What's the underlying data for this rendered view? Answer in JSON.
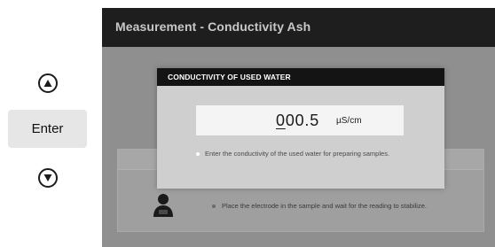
{
  "controls": {
    "up_icon": "triangle-up-icon",
    "enter_label": "Enter",
    "down_icon": "triangle-down-icon"
  },
  "screen": {
    "title": "Measurement - Conductivity Ash",
    "background_hint": "Place the electrode in the sample and wait for the reading to stabilize.",
    "background_icon": "electrode-operator-icon"
  },
  "dialog": {
    "title": "CONDUCTIVITY OF USED WATER",
    "value_cursor_digit": "0",
    "value_rest": "00.5",
    "unit": "µS/cm",
    "help_text": "Enter the conductivity of the used water for preparing samples."
  },
  "colors": {
    "title_bar": "#1e1e1e",
    "screen_dim": "#8f8f8f",
    "dialog_body": "#cfcfcf",
    "field": "#f4f4f4"
  }
}
